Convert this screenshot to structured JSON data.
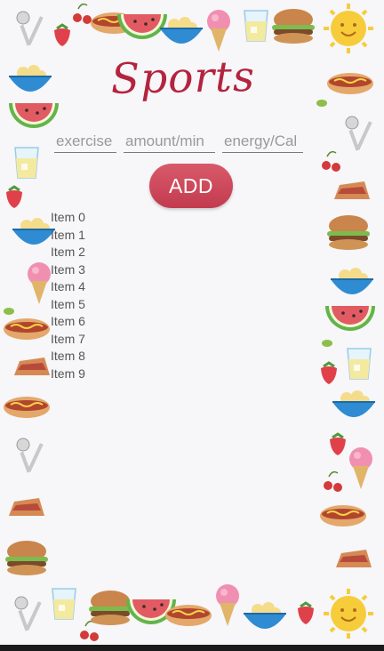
{
  "header": {
    "title": "Sports"
  },
  "form": {
    "exercise_placeholder": "exercise",
    "amount_placeholder": "amount/min",
    "energy_placeholder": "energy/Cal",
    "add_label": "ADD"
  },
  "list": {
    "items": [
      "Item 0",
      "Item 1",
      "Item 2",
      "Item 3",
      "Item 4",
      "Item 5",
      "Item 6",
      "Item 7",
      "Item 8",
      "Item 9"
    ]
  },
  "theme": {
    "accent": "#c23b4e",
    "background": "#f7f6f8"
  }
}
